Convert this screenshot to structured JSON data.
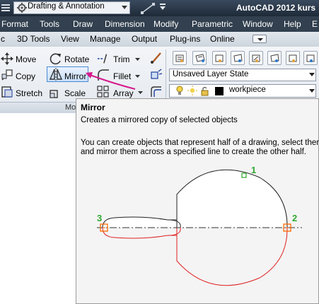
{
  "titlebar": {
    "workspace": "Drafting & Annotation",
    "app_title": "AutoCAD 2012   kurs"
  },
  "menu": {
    "items": [
      "Format",
      "Tools",
      "Draw",
      "Dimension",
      "Modify",
      "Parametric",
      "Window",
      "Help",
      "E"
    ]
  },
  "ribbon_tabs": {
    "items": [
      "c",
      "3D Tools",
      "View",
      "Manage",
      "Output",
      "Plug-ins",
      "Online"
    ]
  },
  "modify_panel": {
    "title": "Mo",
    "tools": {
      "move": "Move",
      "rotate": "Rotate",
      "trim": "Trim",
      "copy": "Copy",
      "mirror": "Mirror",
      "fillet": "Fillet",
      "stretch": "Stretch",
      "scale": "Scale",
      "array": "Array"
    }
  },
  "layers_panel": {
    "layer_state": "Unsaved Layer State",
    "current_layer": "workpiece"
  },
  "tooltip": {
    "title": "Mirror",
    "description": "Creates a mirrored copy of selected objects",
    "detail_line1": "You can create objects that represent half of a drawing, select them,",
    "detail_line2": "and mirror them across a specified line to create the other half.",
    "illustration": {
      "point1": "1",
      "point2": "2",
      "point3": "3"
    }
  },
  "colors": {
    "titlebar": "#2a3746",
    "menubar": "#32404f",
    "highlight": "#4a8ad4",
    "mirror_copy": "#e02020",
    "point_marker": "#2ea82e",
    "annotation_arrow": "#d61a8c"
  }
}
